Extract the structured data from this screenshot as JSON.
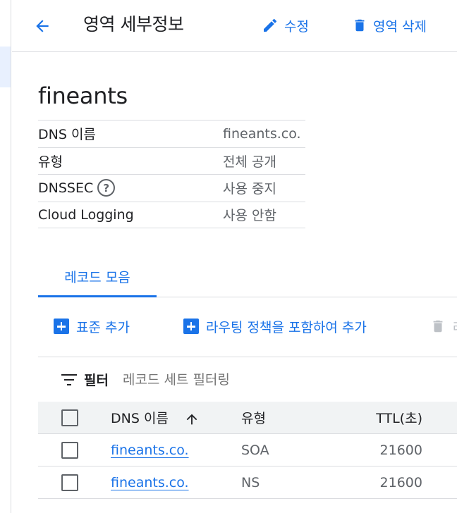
{
  "header": {
    "title": "영역 세부정보",
    "edit_label": "수정",
    "delete_zone_label": "영역 삭제"
  },
  "zone": {
    "name": "fineants",
    "properties": [
      {
        "key": "DNS 이름",
        "value": "fineants.co."
      },
      {
        "key": "유형",
        "value": "전체 공개"
      },
      {
        "key": "DNSSEC",
        "value": "사용 중지",
        "help": "?"
      },
      {
        "key": "Cloud Logging",
        "value": "사용 안함"
      }
    ]
  },
  "tabs": {
    "record_sets": "레코드 모음"
  },
  "toolbar": {
    "add_standard": "표준 추가",
    "add_with_routing": "라우팅 정책을 포함하여 추가",
    "delete_partial": "레"
  },
  "filter": {
    "label": "필터",
    "placeholder": "레코드 세트 필터링"
  },
  "table": {
    "columns": {
      "name": "DNS 이름",
      "type": "유형",
      "ttl": "TTL(초)"
    },
    "rows": [
      {
        "name": "fineants.co.",
        "type": "SOA",
        "ttl": "21600"
      },
      {
        "name": "fineants.co.",
        "type": "NS",
        "ttl": "21600"
      }
    ]
  },
  "colors": {
    "accent": "#1a73e8",
    "text": "#202124",
    "muted": "#5f6368",
    "divider": "#dadce0"
  },
  "icons": {
    "back": "arrow-back-icon",
    "edit": "pencil-icon",
    "delete": "trash-icon",
    "add": "add-box-icon",
    "filter": "filter-list-icon",
    "sort": "arrow-up-icon",
    "help": "help-circle-icon"
  }
}
